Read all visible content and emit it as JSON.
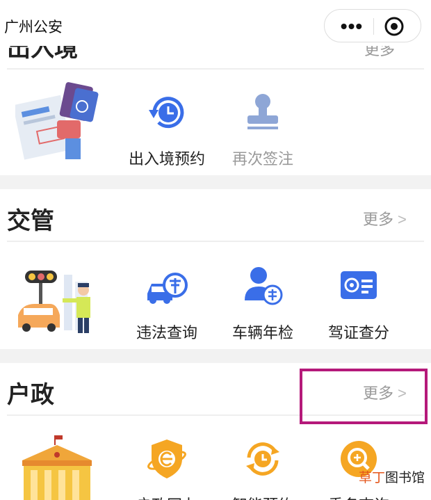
{
  "app": {
    "title": "广州公安"
  },
  "capsule": {
    "more_glyph": "•••"
  },
  "section_crossborder": {
    "title": "出入境",
    "more": "更多",
    "items": [
      {
        "label": "出入境预约",
        "icon": "clock-refresh-icon"
      },
      {
        "label": "再次签注",
        "icon": "stamp-icon"
      }
    ]
  },
  "section_traffic": {
    "title": "交管",
    "more": "更多",
    "chevron": ">",
    "items": [
      {
        "label": "违法查询",
        "icon": "car-fine-icon"
      },
      {
        "label": "车辆年检",
        "icon": "annual-inspection-icon"
      },
      {
        "label": "驾证查分",
        "icon": "license-score-icon"
      }
    ]
  },
  "section_household": {
    "title": "户政",
    "more": "更多",
    "chevron": ">",
    "items": [
      {
        "label": "户政网办",
        "icon": "online-service-icon"
      },
      {
        "label": "智能预约",
        "icon": "smart-booking-icon"
      },
      {
        "label": "重名查询",
        "icon": "name-search-icon"
      }
    ]
  },
  "watermark": {
    "part1": "草丁",
    "part2": "图书馆"
  },
  "colors": {
    "accent_blue": "#3a6ee8",
    "accent_orange": "#f5a623",
    "highlight": "#b5197a"
  }
}
